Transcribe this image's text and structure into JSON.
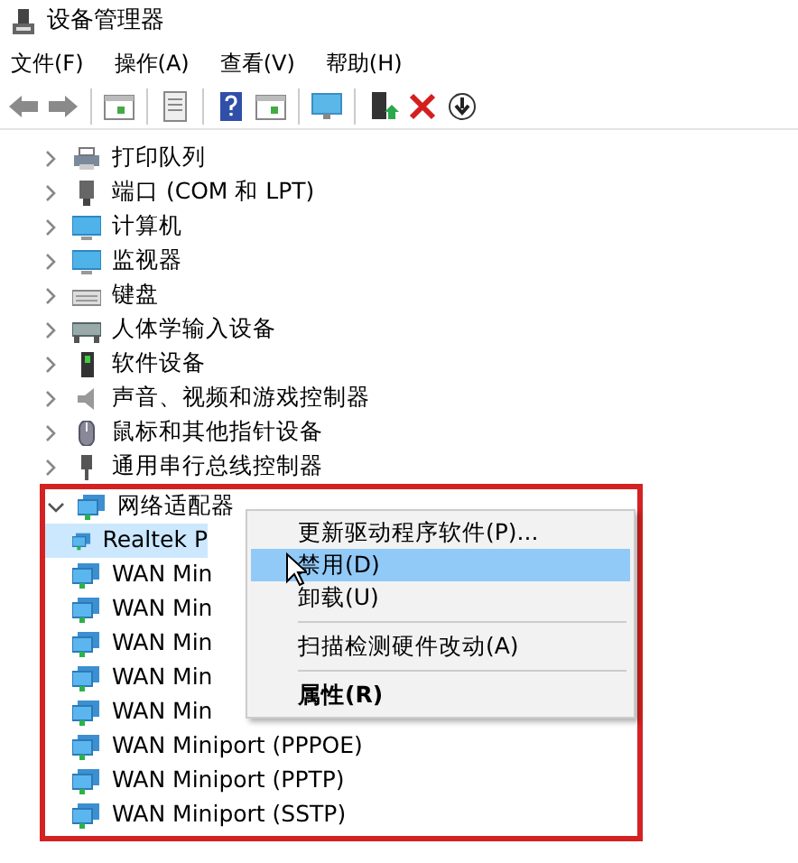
{
  "window": {
    "title": "设备管理器"
  },
  "menu_bar": [
    "文件(F)",
    "操作(A)",
    "查看(V)",
    "帮助(H)"
  ],
  "tree": {
    "items": [
      {
        "label": "打印队列",
        "expanded": false
      },
      {
        "label": "端口 (COM 和 LPT)",
        "expanded": false
      },
      {
        "label": "计算机",
        "expanded": false
      },
      {
        "label": "监视器",
        "expanded": false
      },
      {
        "label": "键盘",
        "expanded": false
      },
      {
        "label": "人体学输入设备",
        "expanded": false
      },
      {
        "label": "软件设备",
        "expanded": false
      },
      {
        "label": "声音、视频和游戏控制器",
        "expanded": false
      },
      {
        "label": "鼠标和其他指针设备",
        "expanded": false
      },
      {
        "label": "通用串行总线控制器",
        "expanded": false
      },
      {
        "label": "网络适配器",
        "expanded": true,
        "highlighted": true,
        "children": [
          {
            "label": "Realtek P",
            "selected": true
          },
          {
            "label": "WAN Min",
            "selected": false
          },
          {
            "label": "WAN Min",
            "selected": false
          },
          {
            "label": "WAN Min",
            "selected": false
          },
          {
            "label": "WAN Min",
            "selected": false
          },
          {
            "label": "WAN Min",
            "selected": false
          },
          {
            "label": "WAN Miniport (PPPOE)",
            "selected": false
          },
          {
            "label": "WAN Miniport (PPTP)",
            "selected": false
          },
          {
            "label": "WAN Miniport (SSTP)",
            "selected": false
          }
        ]
      }
    ]
  },
  "context_menu": [
    {
      "kind": "item",
      "label": "更新驱动程序软件(P)...",
      "selected": false,
      "bold": false
    },
    {
      "kind": "item",
      "label": "禁用(D)",
      "selected": true,
      "bold": false
    },
    {
      "kind": "item",
      "label": "卸载(U)",
      "selected": false,
      "bold": false
    },
    {
      "kind": "separator"
    },
    {
      "kind": "item",
      "label": "扫描检测硬件改动(A)",
      "selected": false,
      "bold": false
    },
    {
      "kind": "separator"
    },
    {
      "kind": "item",
      "label": "属性(R)",
      "selected": false,
      "bold": true
    }
  ]
}
